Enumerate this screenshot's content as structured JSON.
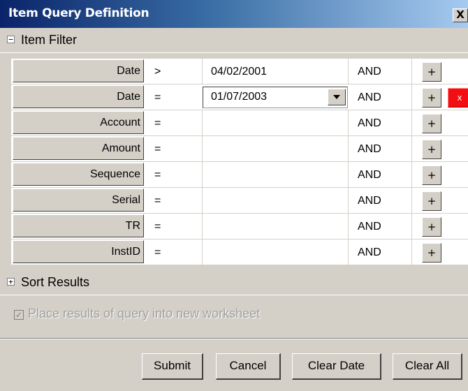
{
  "window": {
    "title": "Item Query Definition",
    "close_label": "X"
  },
  "item_filter": {
    "label": "Item Filter",
    "toggle": "−",
    "rows": [
      {
        "field": "Date",
        "operator": ">",
        "value": "04/02/2001",
        "conjunction": "AND",
        "add": "+"
      },
      {
        "field": "Date",
        "operator": "=",
        "value": "01/07/2003",
        "conjunction": "AND",
        "add": "+",
        "delete": "x"
      },
      {
        "field": "Account",
        "operator": "=",
        "value": "",
        "conjunction": "AND",
        "add": "+"
      },
      {
        "field": "Amount",
        "operator": "=",
        "value": "",
        "conjunction": "AND",
        "add": "+"
      },
      {
        "field": "Sequence",
        "operator": "=",
        "value": "",
        "conjunction": "AND",
        "add": "+"
      },
      {
        "field": "Serial",
        "operator": "=",
        "value": "",
        "conjunction": "AND",
        "add": "+"
      },
      {
        "field": "TR",
        "operator": "=",
        "value": "",
        "conjunction": "AND",
        "add": "+"
      },
      {
        "field": "InstID",
        "operator": "=",
        "value": "",
        "conjunction": "AND",
        "add": "+"
      }
    ]
  },
  "sort_results": {
    "label": "Sort Results",
    "toggle": "+"
  },
  "options": {
    "new_worksheet_label": "Place results of query into new worksheet",
    "new_worksheet_checked": true,
    "check_mark": "✓"
  },
  "buttons": {
    "submit": "Submit",
    "cancel": "Cancel",
    "clear_date": "Clear Date",
    "clear_all": "Clear All"
  }
}
